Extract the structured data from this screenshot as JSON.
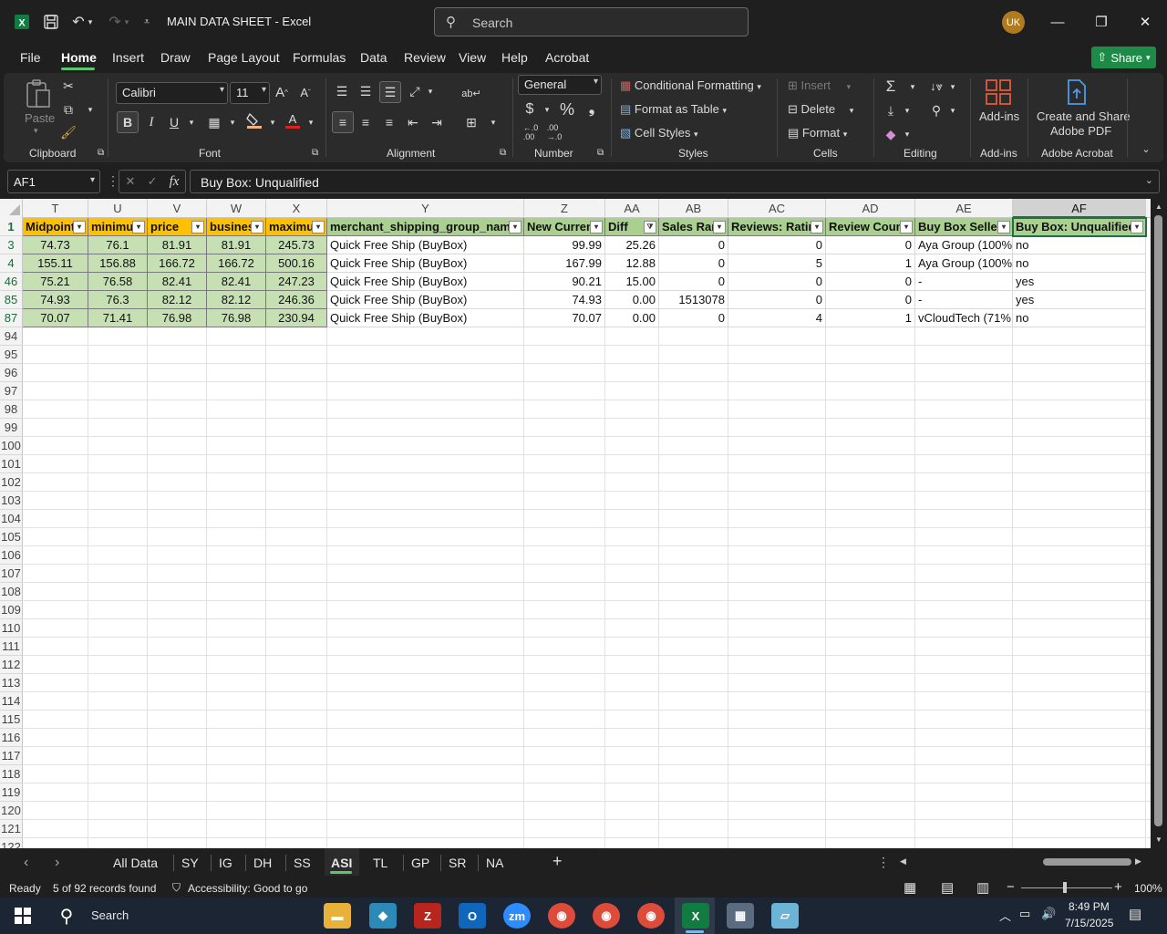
{
  "window": {
    "title": "MAIN DATA SHEET  -  Excel",
    "search_placeholder": "Search",
    "user_initials": "UK"
  },
  "menu": {
    "items": [
      "File",
      "Home",
      "Insert",
      "Draw",
      "Page Layout",
      "Formulas",
      "Data",
      "Review",
      "View",
      "Help",
      "Acrobat"
    ],
    "share_label": "Share"
  },
  "ribbon": {
    "clipboard": {
      "paste": "Paste",
      "label": "Clipboard"
    },
    "font": {
      "name": "Calibri",
      "size": "11",
      "label": "Font",
      "bold": "B",
      "italic": "I",
      "underline": "U"
    },
    "alignment": {
      "label": "Alignment"
    },
    "number": {
      "format": "General",
      "label": "Number",
      "currency": "$",
      "percent": "%"
    },
    "styles": {
      "conditional": "Conditional Formatting",
      "format_table": "Format as Table",
      "cell_styles": "Cell Styles",
      "label": "Styles"
    },
    "cells": {
      "insert": "Insert",
      "delete": "Delete",
      "format": "Format",
      "label": "Cells"
    },
    "editing": {
      "label": "Editing"
    },
    "addins": {
      "button": "Add-ins",
      "label": "Add-ins"
    },
    "acrobat": {
      "button_line1": "Create and Share",
      "button_line2": "Adobe PDF",
      "label": "Adobe Acrobat"
    }
  },
  "formula_bar": {
    "name_box": "AF1",
    "fx": "fx",
    "content": "Buy Box: Unqualified"
  },
  "sheet": {
    "columns": [
      "T",
      "U",
      "V",
      "W",
      "X",
      "Y",
      "Z",
      "AA",
      "AB",
      "AC",
      "AD",
      "AE",
      "AF"
    ],
    "headers": [
      "Midpoint",
      "minimum",
      "price",
      "business",
      "maximum",
      "merchant_shipping_group_name",
      "New Current",
      "Diff",
      "Sales Rank",
      "Reviews: Rating",
      "Review Count",
      "Buy Box Seller",
      "Buy Box: Unqualified"
    ],
    "row_numbers": [
      "1",
      "3",
      "4",
      "46",
      "85",
      "87",
      "94",
      "95",
      "96",
      "97",
      "98",
      "99",
      "100",
      "101",
      "102",
      "103",
      "104",
      "105",
      "106",
      "107",
      "108",
      "109",
      "110",
      "111",
      "112",
      "113",
      "114",
      "115",
      "116",
      "117",
      "118",
      "119",
      "120",
      "121",
      "122"
    ],
    "rows": [
      [
        "74.73",
        "76.1",
        "81.91",
        "81.91",
        "245.73",
        "Quick Free Ship (BuyBox)",
        "99.99",
        "25.26",
        "0",
        "0",
        "0",
        "Aya Group (100%",
        "no"
      ],
      [
        "155.11",
        "156.88",
        "166.72",
        "166.72",
        "500.16",
        "Quick Free Ship (BuyBox)",
        "167.99",
        "12.88",
        "0",
        "5",
        "1",
        "Aya Group (100%",
        "no"
      ],
      [
        "75.21",
        "76.58",
        "82.41",
        "82.41",
        "247.23",
        "Quick Free Ship (BuyBox)",
        "90.21",
        "15.00",
        "0",
        "0",
        "0",
        "-",
        "yes"
      ],
      [
        "74.93",
        "76.3",
        "82.12",
        "82.12",
        "246.36",
        "Quick Free Ship (BuyBox)",
        "74.93",
        "0.00",
        "1513078",
        "0",
        "0",
        "-",
        "yes"
      ],
      [
        "70.07",
        "71.41",
        "76.98",
        "76.98",
        "230.94",
        "Quick Free Ship (BuyBox)",
        "70.07",
        "0.00",
        "0",
        "4",
        "1",
        "vCloudTech (71%",
        "no"
      ]
    ]
  },
  "tabs": [
    "All Data",
    "SY",
    "IG",
    "DH",
    "SS",
    "ASI",
    "TL",
    "GP",
    "SR",
    "NA"
  ],
  "active_tab": "ASI",
  "status": {
    "mode": "Ready",
    "records": "5 of 92 records found",
    "accessibility": "Accessibility: Good to go",
    "zoom": "100%"
  },
  "taskbar": {
    "search": "Search",
    "time": "8:49 PM",
    "date": "7/15/2025"
  },
  "colors": {
    "header_green": "#a9d08e",
    "header_yellow": "#ffc000",
    "data_green": "#c6e0b4",
    "accent": "#1e7145"
  }
}
